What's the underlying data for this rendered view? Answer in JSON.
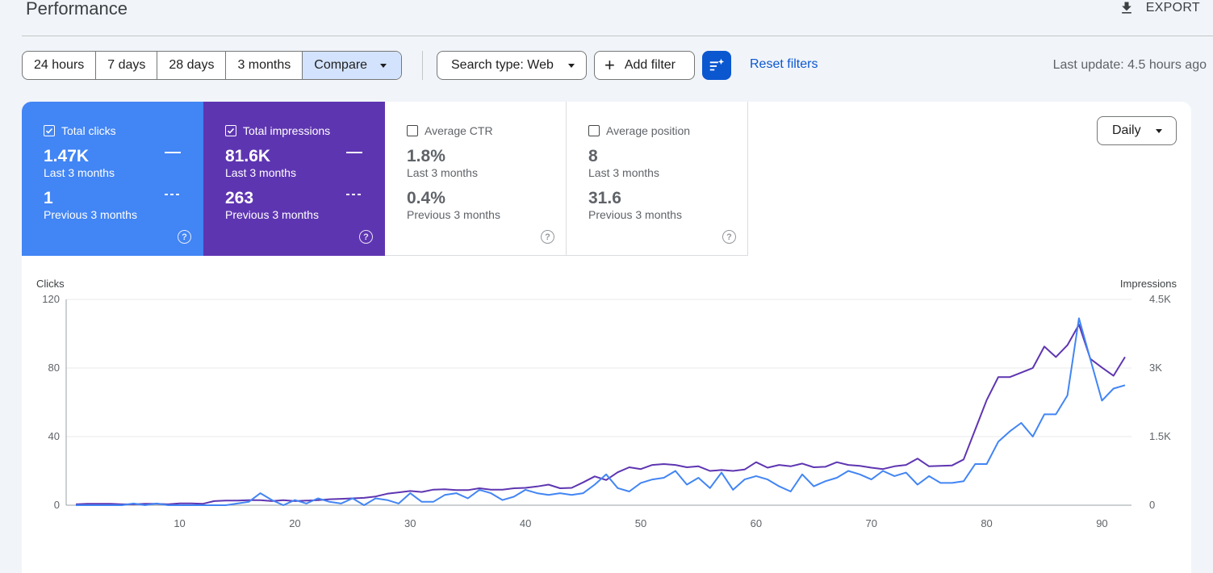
{
  "header": {
    "title": "Performance",
    "export_label": "EXPORT"
  },
  "date_range": {
    "options": [
      "24 hours",
      "7 days",
      "28 days",
      "3 months"
    ],
    "compare_label": "Compare"
  },
  "filters": {
    "search_type": "Search type: Web",
    "add_filter": "Add filter",
    "reset": "Reset filters",
    "last_update": "Last update: 4.5 hours ago"
  },
  "metrics": {
    "clicks": {
      "label": "Total clicks",
      "value": "1.47K",
      "period": "Last 3 months",
      "prev_value": "1",
      "prev_period": "Previous 3 months",
      "checked": true,
      "color": "#4285f4"
    },
    "impressions": {
      "label": "Total impressions",
      "value": "81.6K",
      "period": "Last 3 months",
      "prev_value": "263",
      "prev_period": "Previous 3 months",
      "checked": true,
      "color": "#5e35b1"
    },
    "ctr": {
      "label": "Average CTR",
      "value": "1.8%",
      "period": "Last 3 months",
      "prev_value": "0.4%",
      "prev_period": "Previous 3 months",
      "checked": false
    },
    "position": {
      "label": "Average position",
      "value": "8",
      "period": "Last 3 months",
      "prev_value": "31.6",
      "prev_period": "Previous 3 months",
      "checked": false
    }
  },
  "granularity": "Daily",
  "chart_data": {
    "type": "line",
    "xlabel": "",
    "y_left_label": "Clicks",
    "y_right_label": "Impressions",
    "x_ticks": [
      10,
      20,
      30,
      40,
      50,
      60,
      70,
      80,
      90
    ],
    "y_left_ticks": [
      "0",
      "40",
      "80",
      "120"
    ],
    "y_right_ticks": [
      "0",
      "1.5K",
      "3K",
      "4.5K"
    ],
    "ylim_left": [
      0,
      120
    ],
    "ylim_right": [
      0,
      4500
    ],
    "x": [
      1,
      2,
      3,
      4,
      5,
      6,
      7,
      8,
      9,
      10,
      11,
      12,
      13,
      14,
      15,
      16,
      17,
      18,
      19,
      20,
      21,
      22,
      23,
      24,
      25,
      26,
      27,
      28,
      29,
      30,
      31,
      32,
      33,
      34,
      35,
      36,
      37,
      38,
      39,
      40,
      41,
      42,
      43,
      44,
      45,
      46,
      47,
      48,
      49,
      50,
      51,
      52,
      53,
      54,
      55,
      56,
      57,
      58,
      59,
      60,
      61,
      62,
      63,
      64,
      65,
      66,
      67,
      68,
      69,
      70,
      71,
      72,
      73,
      74,
      75,
      76,
      77,
      78,
      79,
      80,
      81,
      82,
      83,
      84,
      85,
      86,
      87,
      88,
      89,
      90,
      91,
      92
    ],
    "series": [
      {
        "name": "Clicks",
        "axis": "left",
        "color": "#4285f4",
        "values": [
          0,
          0,
          0,
          0,
          0,
          1,
          0,
          1,
          0,
          0,
          0,
          0,
          0,
          0,
          1,
          2,
          7,
          3,
          0,
          3,
          1,
          4,
          2,
          1,
          4,
          0,
          4,
          3,
          1,
          7,
          2,
          2,
          6,
          7,
          4,
          9,
          7,
          3,
          5,
          9,
          7,
          6,
          7,
          6,
          7,
          12,
          18,
          10,
          8,
          13,
          15,
          16,
          20,
          12,
          16,
          10,
          19,
          9,
          15,
          17,
          15,
          11,
          8,
          18,
          11,
          14,
          16,
          20,
          18,
          15,
          20,
          17,
          19,
          12,
          17,
          13,
          13,
          14,
          24,
          24,
          37,
          43,
          48,
          40,
          53,
          53,
          64,
          109,
          85,
          61,
          68,
          70,
          74
        ]
      },
      {
        "name": "Impressions",
        "axis": "right",
        "color": "#5e35b1",
        "values": [
          20,
          30,
          30,
          30,
          20,
          20,
          30,
          30,
          20,
          40,
          40,
          30,
          90,
          100,
          100,
          110,
          110,
          90,
          110,
          90,
          100,
          110,
          130,
          140,
          150,
          160,
          190,
          250,
          280,
          310,
          290,
          340,
          350,
          330,
          330,
          370,
          340,
          340,
          370,
          380,
          410,
          450,
          370,
          380,
          500,
          630,
          550,
          720,
          830,
          790,
          880,
          900,
          880,
          830,
          850,
          750,
          770,
          750,
          780,
          940,
          820,
          880,
          850,
          910,
          830,
          840,
          940,
          880,
          860,
          820,
          790,
          850,
          880,
          1020,
          850,
          860,
          870,
          1000,
          1650,
          2300,
          2800,
          2800,
          2900,
          3000,
          3470,
          3240,
          3500,
          3950,
          3200,
          3010,
          2830,
          3240,
          3300
        ]
      }
    ]
  }
}
